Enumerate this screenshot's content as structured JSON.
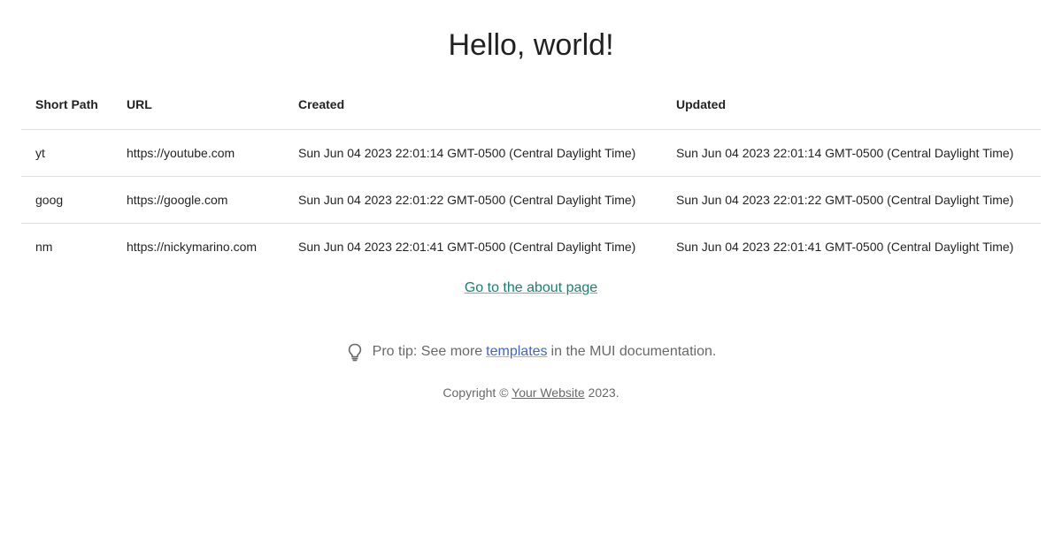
{
  "page": {
    "title": "Hello, world!"
  },
  "table": {
    "headers": {
      "short_path": "Short Path",
      "url": "URL",
      "created": "Created",
      "updated": "Updated"
    },
    "rows": [
      {
        "short_path": "yt",
        "url": "https://youtube.com",
        "created": "Sun Jun 04 2023 22:01:14 GMT-0500 (Central Daylight Time)",
        "updated": "Sun Jun 04 2023 22:01:14 GMT-0500 (Central Daylight Time)"
      },
      {
        "short_path": "goog",
        "url": "https://google.com",
        "created": "Sun Jun 04 2023 22:01:22 GMT-0500 (Central Daylight Time)",
        "updated": "Sun Jun 04 2023 22:01:22 GMT-0500 (Central Daylight Time)"
      },
      {
        "short_path": "nm",
        "url": "https://nickymarino.com",
        "created": "Sun Jun 04 2023 22:01:41 GMT-0500 (Central Daylight Time)",
        "updated": "Sun Jun 04 2023 22:01:41 GMT-0500 (Central Daylight Time)"
      }
    ]
  },
  "about_link": {
    "label": "Go to the about page"
  },
  "pro_tip": {
    "icon": "lightbulb-icon",
    "prefix": "Pro tip: See more",
    "link_label": "templates",
    "suffix": "in the MUI documentation."
  },
  "footer": {
    "prefix": "Copyright ©",
    "link_label": "Your Website",
    "suffix": "2023."
  },
  "colors": {
    "link_primary": "#1a7f72",
    "link_secondary": "#3f65c8",
    "divider": "#e0e0e0"
  }
}
